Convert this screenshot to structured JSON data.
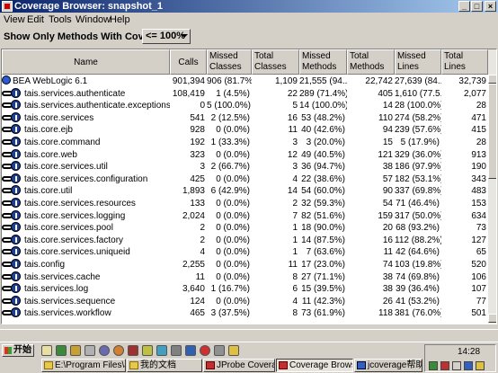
{
  "window": {
    "title": "Coverage Browser: snapshot_1"
  },
  "menu": [
    "View",
    "Edit",
    "Tools",
    "Window",
    "Help"
  ],
  "filter": {
    "label": "Show Only Methods With Coverage:",
    "value": "<= 100%"
  },
  "table": {
    "columns": [
      "Name",
      "Calls",
      "Missed Classes",
      "Total Classes",
      "Missed Methods",
      "Total Methods",
      "Missed Lines",
      "Total Lines"
    ],
    "rows": [
      {
        "name": "BEA WebLogic 6.1",
        "calls": "901,394",
        "missed_classes": "906 (81.7%)",
        "total_classes": "1,109",
        "missed_methods": "21,555 (94....",
        "total_methods": "22,742",
        "missed_lines": "27,639 (84....",
        "total_lines": "32,739"
      },
      {
        "name": "tais.services.authenticate",
        "calls": "108,419",
        "missed_classes": "1 (4.5%)",
        "total_classes": "22",
        "missed_methods": "289 (71.4%)",
        "total_methods": "405",
        "missed_lines": "1,610 (77.5....",
        "total_lines": "2,077"
      },
      {
        "name": "tais.services.authenticate.exceptions",
        "calls": "0",
        "missed_classes": "5 (100.0%)",
        "total_classes": "5",
        "missed_methods": "14 (100.0%)",
        "total_methods": "14",
        "missed_lines": "28 (100.0%)",
        "total_lines": "28"
      },
      {
        "name": "tais.core.services",
        "calls": "541",
        "missed_classes": "2 (12.5%)",
        "total_classes": "16",
        "missed_methods": "53 (48.2%)",
        "total_methods": "110",
        "missed_lines": "274 (58.2%)",
        "total_lines": "471"
      },
      {
        "name": "tais.core.ejb",
        "calls": "928",
        "missed_classes": "0 (0.0%)",
        "total_classes": "11",
        "missed_methods": "40 (42.6%)",
        "total_methods": "94",
        "missed_lines": "239 (57.6%)",
        "total_lines": "415"
      },
      {
        "name": "tais.core.command",
        "calls": "192",
        "missed_classes": "1 (33.3%)",
        "total_classes": "3",
        "missed_methods": "3 (20.0%)",
        "total_methods": "15",
        "missed_lines": "5 (17.9%)",
        "total_lines": "28"
      },
      {
        "name": "tais.core.web",
        "calls": "323",
        "missed_classes": "0 (0.0%)",
        "total_classes": "12",
        "missed_methods": "49 (40.5%)",
        "total_methods": "121",
        "missed_lines": "329 (36.0%)",
        "total_lines": "913"
      },
      {
        "name": "tais.core.services.util",
        "calls": "3",
        "missed_classes": "2 (66.7%)",
        "total_classes": "3",
        "missed_methods": "36 (94.7%)",
        "total_methods": "38",
        "missed_lines": "186 (97.9%)",
        "total_lines": "190"
      },
      {
        "name": "tais.core.services.configuration",
        "calls": "425",
        "missed_classes": "0 (0.0%)",
        "total_classes": "4",
        "missed_methods": "22 (38.6%)",
        "total_methods": "57",
        "missed_lines": "182 (53.1%)",
        "total_lines": "343"
      },
      {
        "name": "tais.core.util",
        "calls": "1,893",
        "missed_classes": "6 (42.9%)",
        "total_classes": "14",
        "missed_methods": "54 (60.0%)",
        "total_methods": "90",
        "missed_lines": "337 (69.8%)",
        "total_lines": "483"
      },
      {
        "name": "tais.core.services.resources",
        "calls": "133",
        "missed_classes": "0 (0.0%)",
        "total_classes": "2",
        "missed_methods": "32 (59.3%)",
        "total_methods": "54",
        "missed_lines": "71 (46.4%)",
        "total_lines": "153"
      },
      {
        "name": "tais.core.services.logging",
        "calls": "2,024",
        "missed_classes": "0 (0.0%)",
        "total_classes": "7",
        "missed_methods": "82 (51.6%)",
        "total_methods": "159",
        "missed_lines": "317 (50.0%)",
        "total_lines": "634"
      },
      {
        "name": "tais.core.services.pool",
        "calls": "2",
        "missed_classes": "0 (0.0%)",
        "total_classes": "1",
        "missed_methods": "18 (90.0%)",
        "total_methods": "20",
        "missed_lines": "68 (93.2%)",
        "total_lines": "73"
      },
      {
        "name": "tais.core.services.factory",
        "calls": "2",
        "missed_classes": "0 (0.0%)",
        "total_classes": "1",
        "missed_methods": "14 (87.5%)",
        "total_methods": "16",
        "missed_lines": "112 (88.2%)",
        "total_lines": "127"
      },
      {
        "name": "tais.core.services.uniqueid",
        "calls": "4",
        "missed_classes": "0 (0.0%)",
        "total_classes": "1",
        "missed_methods": "7 (63.6%)",
        "total_methods": "11",
        "missed_lines": "42 (64.6%)",
        "total_lines": "65"
      },
      {
        "name": "tais.config",
        "calls": "2,255",
        "missed_classes": "0 (0.0%)",
        "total_classes": "11",
        "missed_methods": "17 (23.0%)",
        "total_methods": "74",
        "missed_lines": "103 (19.8%)",
        "total_lines": "520"
      },
      {
        "name": "tais.services.cache",
        "calls": "11",
        "missed_classes": "0 (0.0%)",
        "total_classes": "8",
        "missed_methods": "27 (71.1%)",
        "total_methods": "38",
        "missed_lines": "74 (69.8%)",
        "total_lines": "106"
      },
      {
        "name": "tais.services.log",
        "calls": "3,640",
        "missed_classes": "1 (16.7%)",
        "total_classes": "6",
        "missed_methods": "15 (39.5%)",
        "total_methods": "38",
        "missed_lines": "39 (36.4%)",
        "total_lines": "107"
      },
      {
        "name": "tais.services.sequence",
        "calls": "124",
        "missed_classes": "0 (0.0%)",
        "total_classes": "4",
        "missed_methods": "11 (42.3%)",
        "total_methods": "26",
        "missed_lines": "41 (53.2%)",
        "total_lines": "77"
      },
      {
        "name": "tais.services.workflow",
        "calls": "465",
        "missed_classes": "3 (37.5%)",
        "total_classes": "8",
        "missed_methods": "73 (61.9%)",
        "total_methods": "118",
        "missed_lines": "381 (76.0%)",
        "total_lines": "501"
      }
    ]
  },
  "taskbar": {
    "start": "开始",
    "clock": "14:28",
    "tasks": [
      "E:\\Program Files\\J...",
      "我的文档",
      "JProbe Coverage ...",
      "Coverage Browse...",
      "jcoverage帮助.d..."
    ]
  }
}
